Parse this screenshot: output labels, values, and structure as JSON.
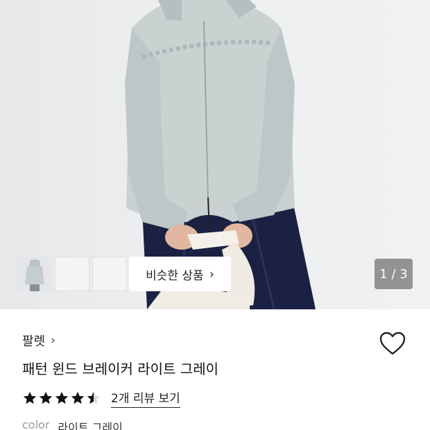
{
  "gallery": {
    "similar_button_label": "비슷한 상품",
    "page_counter": "1 / 3"
  },
  "product": {
    "brand": "팔렛",
    "title": "패턴 윈드 브레이커 라이트 그레이",
    "rating": 4.5,
    "review_link": "2개 리뷰 보기",
    "color_label": "color",
    "color_value": "라이트 그레이"
  },
  "colors": {
    "jacket": "#c6cfcf",
    "star": "#111111"
  }
}
